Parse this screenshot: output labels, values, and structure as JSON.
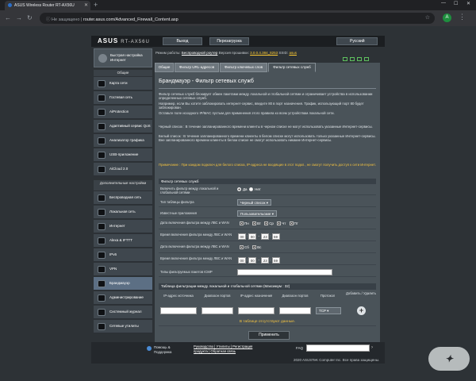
{
  "browser": {
    "tab_title": "ASUS Wireless Router RT-AX56U",
    "address_insecure": "Не защищено",
    "address_url": "router.asus.com/Advanced_Firewall_Content.asp",
    "profile_initial": "A"
  },
  "header": {
    "logo": "ASUS",
    "model": "RT-AX56U",
    "logout": "Выход",
    "reboot": "Перезагрузка",
    "language": "Русский"
  },
  "status": {
    "mode_label": "Режим работы:",
    "mode_value": "Беспроводной роутер",
    "fw_label": "Версия прошивки:",
    "fw_value": "3.0.0.4.384_8253",
    "ssid_label": "SSID:",
    "ssid_value": "asus"
  },
  "sidebar": {
    "quick_setup": "Быстрая настройка Интернет",
    "general_header": "Общие",
    "general_items": [
      {
        "label": "Карта сети",
        "icon": "network-map-icon"
      },
      {
        "label": "Гостевая сеть",
        "icon": "guest-network-icon"
      },
      {
        "label": "AiProtection",
        "icon": "aiprotection-icon"
      },
      {
        "label": "Адаптивный сервис QoS",
        "icon": "qos-icon"
      },
      {
        "label": "Анализатор трафика",
        "icon": "traffic-analyzer-icon"
      },
      {
        "label": "USB-приложение",
        "icon": "usb-icon"
      },
      {
        "label": "AiCloud 2.0",
        "icon": "cloud-icon"
      }
    ],
    "advanced_header": "Дополнительные настройки",
    "advanced_items": [
      {
        "label": "Беспроводная сеть",
        "icon": "wireless-icon"
      },
      {
        "label": "Локальная сеть",
        "icon": "lan-icon"
      },
      {
        "label": "Интернет",
        "icon": "internet-icon"
      },
      {
        "label": "Alexa & IFTTT",
        "icon": "alexa-icon"
      },
      {
        "label": "IPv6",
        "icon": "ipv6-icon"
      },
      {
        "label": "VPN",
        "icon": "vpn-icon"
      },
      {
        "label": "Брандмауэр",
        "icon": "firewall-icon"
      },
      {
        "label": "Администрирование",
        "icon": "administration-icon"
      },
      {
        "label": "Системный журнал",
        "icon": "system-log-icon"
      },
      {
        "label": "Сетевые утилиты",
        "icon": "network-tools-icon"
      }
    ]
  },
  "tabs": [
    "Общие",
    "Фильтр URL-адресов",
    "Фильтр ключевых слов",
    "Фильтр сетевых служб"
  ],
  "page": {
    "title": "Брандмауэр - Фильтр сетевых служб",
    "desc1": "Фильтр сетевых служб блокирует обмен пакетами между локальной и глобальной сетями и ограничивает устройства в использовании определенных сетевых служб.",
    "desc2": "Например, если Вы хотите заблокировать интернет-сервис, введите 80 в порт назначения. Трафик, использующий порт 80 будет заблокирован.",
    "desc3": "Оставьте поле исходного IP/MAC пустым для применения этого правила ко всем устройствам локальной сети.",
    "desc4": "Черный список : В течение запланированного времени клиенты в черном списке не могут использовать указанные Интернет-сервисы.",
    "desc5": "Белый список : В течение запланированного времени клиенты в белом списке могут использовать только указанные Интернет-сервисы. Вне запланированного времени клиенты в белом списке не смогут использовать никакие Интернет-сервисы.",
    "note": "Примечание : При каждом подключ для белого списка, IP-адреса не входящие в этот подкл., не смогут получить доступ к сети Интернет."
  },
  "form": {
    "group_title": "Фильтр сетевых служб",
    "enable_label": "Включить фильтр между локальной и глобальной сетями",
    "yes": "Да",
    "no": "Нет",
    "type_label": "Тип таблицы фильтра",
    "type_value": "Черный список",
    "apps_label": "Известные приложения",
    "apps_value": "Пользовательские",
    "dates1_label": "Дата включения фильтра между ЛВС и WAN",
    "days1": [
      "Пн",
      "Вт",
      "Ср",
      "Чт",
      "Пт"
    ],
    "time1_label": "Время включения фильтра между ЛВС и WAN",
    "time1": [
      "00",
      "00",
      "23",
      "59"
    ],
    "dates2_label": "Дата включения фильтра между ЛВС и WAN",
    "days2": [
      "Сб",
      "Вс"
    ],
    "time2_label": "Время включения фильтра между ЛВС и WAN",
    "time2": [
      "00",
      "00",
      "23",
      "59"
    ],
    "icmp_label": "Типы фильтруемых пакетов ICMP"
  },
  "table": {
    "title": "Таблица фильтрации между локальной и глобальной сетями (Максимум : 32)",
    "headers": [
      "IP-адрес источника",
      "Диапазон портов",
      "IP-адрес назначения",
      "Диапазон портов",
      "Протокол",
      "Добавить / Удалить"
    ],
    "protocol_value": "TCP",
    "empty_message": "В таблице отсутствуют данные.",
    "apply": "Применить"
  },
  "footer": {
    "help_line1": "Помощь &",
    "help_line2": "Поддержка",
    "links_line1": "Руководство | Утилиты | Регистрация",
    "links_line2": "продукта | Обратная связь",
    "faq": "FAQ",
    "copyright": "2020 ASUSTeK Computer Inc. Все права защищены."
  },
  "colors": {
    "page_bg": "#2d3236",
    "content_bg": "#4a5359",
    "active_item": "#5c6f84",
    "note": "#f0c040"
  }
}
